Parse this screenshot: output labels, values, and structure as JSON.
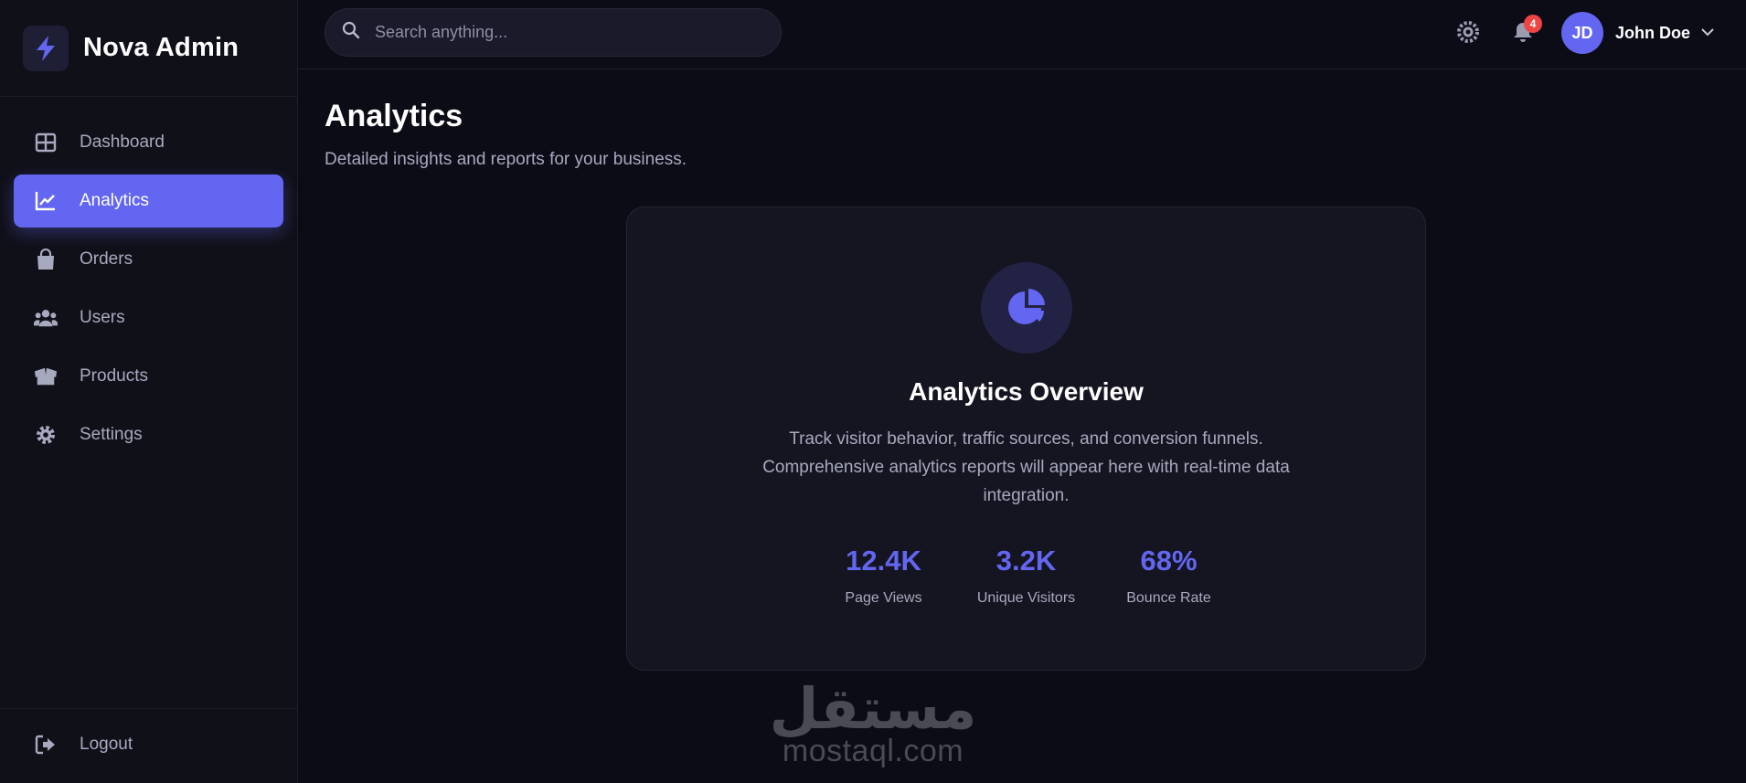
{
  "brand": {
    "name": "Nova Admin"
  },
  "sidebar": {
    "items": [
      {
        "label": "Dashboard",
        "icon": "grid-icon",
        "active": false
      },
      {
        "label": "Analytics",
        "icon": "chart-line-icon",
        "active": true
      },
      {
        "label": "Orders",
        "icon": "shopping-bag-icon",
        "active": false
      },
      {
        "label": "Users",
        "icon": "users-icon",
        "active": false
      },
      {
        "label": "Products",
        "icon": "box-open-icon",
        "active": false
      },
      {
        "label": "Settings",
        "icon": "gear-icon",
        "active": false
      }
    ],
    "logout_label": "Logout"
  },
  "header": {
    "search_placeholder": "Search anything...",
    "notifications_count": "4",
    "user": {
      "initials": "JD",
      "name": "John Doe"
    }
  },
  "page": {
    "title": "Analytics",
    "subtitle": "Detailed insights and reports for your business."
  },
  "card": {
    "title": "Analytics Overview",
    "description": "Track visitor behavior, traffic sources, and conversion funnels. Comprehensive analytics reports will appear here with real-time data integration.",
    "stats": [
      {
        "value": "12.4K",
        "label": "Page Views"
      },
      {
        "value": "3.2K",
        "label": "Unique Visitors"
      },
      {
        "value": "68%",
        "label": "Bounce Rate"
      }
    ]
  },
  "watermark": {
    "arabic": "مستقل",
    "latin": "mostaql.com"
  },
  "colors": {
    "accent": "#6366f1",
    "background": "#0c0c17",
    "sidebar": "#101019",
    "card": "#151521",
    "badge": "#ef4444"
  }
}
